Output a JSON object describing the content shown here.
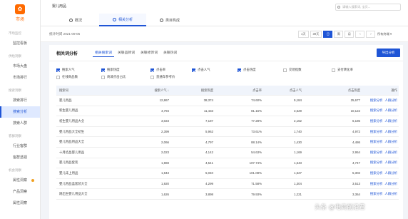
{
  "sidebar": {
    "logo": "市场",
    "items": [
      {
        "type": "group",
        "label": "市场监控"
      },
      {
        "type": "item",
        "label": "监控看板"
      },
      {
        "type": "group",
        "label": "供给洞察"
      },
      {
        "type": "item",
        "label": "市场大盘"
      },
      {
        "type": "item",
        "label": "市场排行"
      },
      {
        "type": "group",
        "label": "搜索洞察"
      },
      {
        "type": "item",
        "label": "搜索排行"
      },
      {
        "type": "item",
        "label": "搜索分析",
        "active": true
      },
      {
        "type": "item",
        "label": "搜索人群"
      },
      {
        "type": "group",
        "label": "客群洞察"
      },
      {
        "type": "item",
        "label": "行业客群"
      },
      {
        "type": "item",
        "label": "客群透视"
      },
      {
        "type": "group",
        "label": "机会洞察"
      },
      {
        "type": "item",
        "label": "属性洞察",
        "dot": true
      },
      {
        "type": "item",
        "label": "产品洞察"
      },
      {
        "type": "item",
        "label": "属性洞察"
      }
    ]
  },
  "header": {
    "breadcrumb": "婴儿用品",
    "tabs": [
      {
        "label": "概况"
      },
      {
        "label": "相关分析",
        "active": true
      },
      {
        "label": "类目构成"
      }
    ],
    "search_placeholder": "请输入搜索词, 宝贝..."
  },
  "datebar": {
    "date_text": "统计时间 2021-09-05",
    "periods": [
      {
        "label": "1天"
      },
      {
        "label": "30天"
      },
      {
        "label": "日",
        "active": true
      },
      {
        "label": "周"
      },
      {
        "label": "月"
      },
      {
        "label": "‹"
      },
      {
        "label": "›"
      }
    ],
    "terminal": "所有终端"
  },
  "panel": {
    "title": "相关词分析",
    "subtabs": [
      {
        "label": "相关搜索词",
        "active": true
      },
      {
        "label": "关联品牌词"
      },
      {
        "label": "关联修饰词"
      },
      {
        "label": "关联热词"
      }
    ],
    "download": "导出分析",
    "checkboxes": [
      {
        "label": "搜索人气",
        "on": true
      },
      {
        "label": "搜索热度",
        "on": true
      },
      {
        "label": "点击率",
        "on": true
      },
      {
        "label": "点击人气",
        "on": true
      },
      {
        "label": "点击热度",
        "on": true
      },
      {
        "label": "交易指数",
        "on": false
      },
      {
        "label": "支付转化率",
        "on": false
      },
      {
        "label": "在线商品数",
        "on": false
      },
      {
        "label": "商城点击占比",
        "on": false
      },
      {
        "label": "直通车参考价",
        "on": false
      }
    ],
    "columns": [
      "搜索词",
      "搜索人气 ↓",
      "搜索热度",
      "点击率",
      "点击人气",
      "点击热度",
      "操作"
    ],
    "op_links": [
      "搜索分析",
      "人群分析"
    ],
    "rows": [
      [
        "婴儿用品",
        "12,867",
        "38,374",
        "74.60%",
        "9,184",
        "25,677"
      ],
      [
        "新生婴儿用品",
        "4,794",
        "11,433",
        "81.16%",
        "3,529",
        "10,122"
      ],
      [
        "初生婴儿用品大全",
        "3,023",
        "7,187",
        "77.28%",
        "2,162",
        "6,185"
      ],
      [
        "婴儿用品大全初生",
        "2,399",
        "5,962",
        "73.61%",
        "1,740",
        "4,972"
      ],
      [
        "婴儿用品用品大全",
        "2,066",
        "4,797",
        "88.14%",
        "1,430",
        "4,486"
      ],
      [
        "十月结晶婴儿用品",
        "2,023",
        "4,142",
        "54.63%",
        "1,169",
        "2,954"
      ],
      [
        "婴儿用品套装",
        "1,969",
        "4,541",
        "107.74%",
        "1,643",
        "4,747"
      ],
      [
        "婴儿床上用品",
        "1,943",
        "5,040",
        "101.08%",
        "1,527",
        "5,302"
      ],
      [
        "婴儿用品盒套装大全",
        "1,920",
        "4,299",
        "71.58%",
        "1,304",
        "3,513"
      ],
      [
        "刚出生婴儿用品大全",
        "1,626",
        "3,898",
        "79.93%",
        "1,221",
        "3,364"
      ]
    ]
  },
  "watermark": "头条 @电商前沿君"
}
